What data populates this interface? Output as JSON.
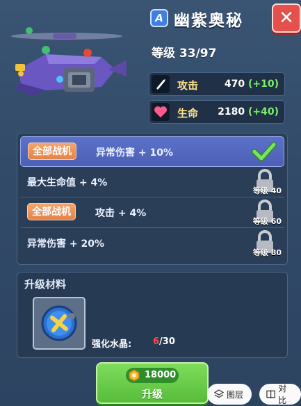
{
  "ship": {
    "rank": "A",
    "name": "幽紫奥秘",
    "level_text": "等级 33/97"
  },
  "stats": [
    {
      "label": "攻击",
      "value": "470",
      "bonus": "(+10)",
      "icon": "sword-icon"
    },
    {
      "label": "生命",
      "value": "2180",
      "bonus": "(+40)",
      "icon": "heart-icon"
    }
  ],
  "traits": [
    {
      "tag": "全部战机",
      "text": "异常伤害 + 10%",
      "unlocked": true
    },
    {
      "tag": "",
      "text": "最大生命值 + 4%",
      "lock_level": "等级 40"
    },
    {
      "tag": "全部战机",
      "text": "攻击 + 4%",
      "lock_level": "等级 60"
    },
    {
      "tag": "",
      "text": "异常伤害 + 20%",
      "lock_level": "等级 80"
    }
  ],
  "materials": {
    "title": "升级材料",
    "item_name": "强化水晶:",
    "have": "6",
    "need": "/30"
  },
  "upgrade": {
    "cost": "18000",
    "label": "升级"
  },
  "bottom": {
    "layers_label": "图层",
    "compare_label": "对比"
  },
  "colors": {
    "accent_green": "#7cf06b",
    "stat_label": "#ffe38a",
    "insufficient": "#ff4a4a"
  }
}
